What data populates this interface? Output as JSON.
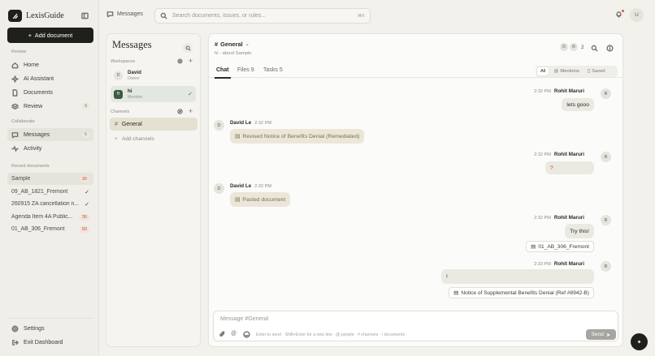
{
  "app": {
    "brand": "LexisGuide",
    "add_document": "Add document"
  },
  "sidebar": {
    "review_header": "Review",
    "nav": [
      {
        "label": "Home",
        "icon": "home-icon"
      },
      {
        "label": "AI Assistant",
        "icon": "sparkle-icon"
      },
      {
        "label": "Documents",
        "icon": "document-icon"
      },
      {
        "label": "Review",
        "icon": "layers-icon",
        "badge": "9"
      }
    ],
    "collaborate_header": "Collaborate",
    "collab": [
      {
        "label": "Messages",
        "icon": "chat-icon",
        "badge": "5"
      },
      {
        "label": "Activity",
        "icon": "activity-icon"
      }
    ],
    "recent_header": "Recent documents",
    "recent": [
      {
        "label": "Sample",
        "count": "30"
      },
      {
        "label": "09_AB_1821_Fremont",
        "check": "✓"
      },
      {
        "label": "260915 ZA cancellation n...",
        "check": "✓"
      },
      {
        "label": "Agenda Item 4A Public...",
        "count": "30"
      },
      {
        "label": "01_AB_306_Fremont",
        "count": "50"
      }
    ],
    "settings": "Settings",
    "exit": "Exit Dashboard"
  },
  "topbar": {
    "section": "Messages",
    "search_placeholder": "Search documents, issues, or rules...",
    "search_shortcut": "⌘K",
    "user_initial": "U"
  },
  "messages_panel": {
    "title": "Messages",
    "workspaces_header": "Workspaces",
    "workspaces": [
      {
        "initial": "D",
        "name": "David",
        "role": "Owner"
      },
      {
        "initial": "H",
        "name": "hi",
        "role": "Member"
      }
    ],
    "channels_header": "Channels",
    "channels": [
      {
        "name": "General"
      }
    ],
    "add_channels": "Add channels"
  },
  "channel": {
    "name": "General",
    "subtitle": "hi · about Sample",
    "presence": [
      "D",
      "R"
    ],
    "presence_count": "2",
    "tabs": [
      "Chat",
      "Files 9",
      "Tasks 5"
    ],
    "filters": [
      "All",
      "Mentions",
      "Saved"
    ]
  },
  "messages": [
    {
      "time": "2:32 PM",
      "author": "Rohit Maruri",
      "initial": "R",
      "text": "lets gooo"
    },
    {
      "time": "2:32 PM",
      "author": "David Le",
      "initial": "D",
      "doc": "Revised Notice of Benefits Denial (Remediated)"
    },
    {
      "time": "2:32 PM",
      "author": "Rohit Maruri",
      "initial": "R",
      "text": "?"
    },
    {
      "time": "2:32 PM",
      "author": "David Le",
      "initial": "D",
      "doc": "Pasted document"
    },
    {
      "time": "2:32 PM",
      "author": "Rohit Maruri",
      "initial": "R",
      "text": "Try this!",
      "attachment": "01_AB_306_Fremont"
    },
    {
      "time": "2:33 PM",
      "author": "Rohit Maruri",
      "initial": "R",
      "text": "!",
      "attachment": "Notice of Supplemental Benefits Denial (Ref #8942-B)"
    }
  ],
  "composer": {
    "placeholder": "Message #General",
    "hint": "Enter to send · Shift+Enter for a new line · @ people · # channels · / documents",
    "send": "Send"
  },
  "colors": {
    "accent": "#1f1f1c",
    "background": "#f2f1ec",
    "active_channel": "#e6e0d2"
  }
}
